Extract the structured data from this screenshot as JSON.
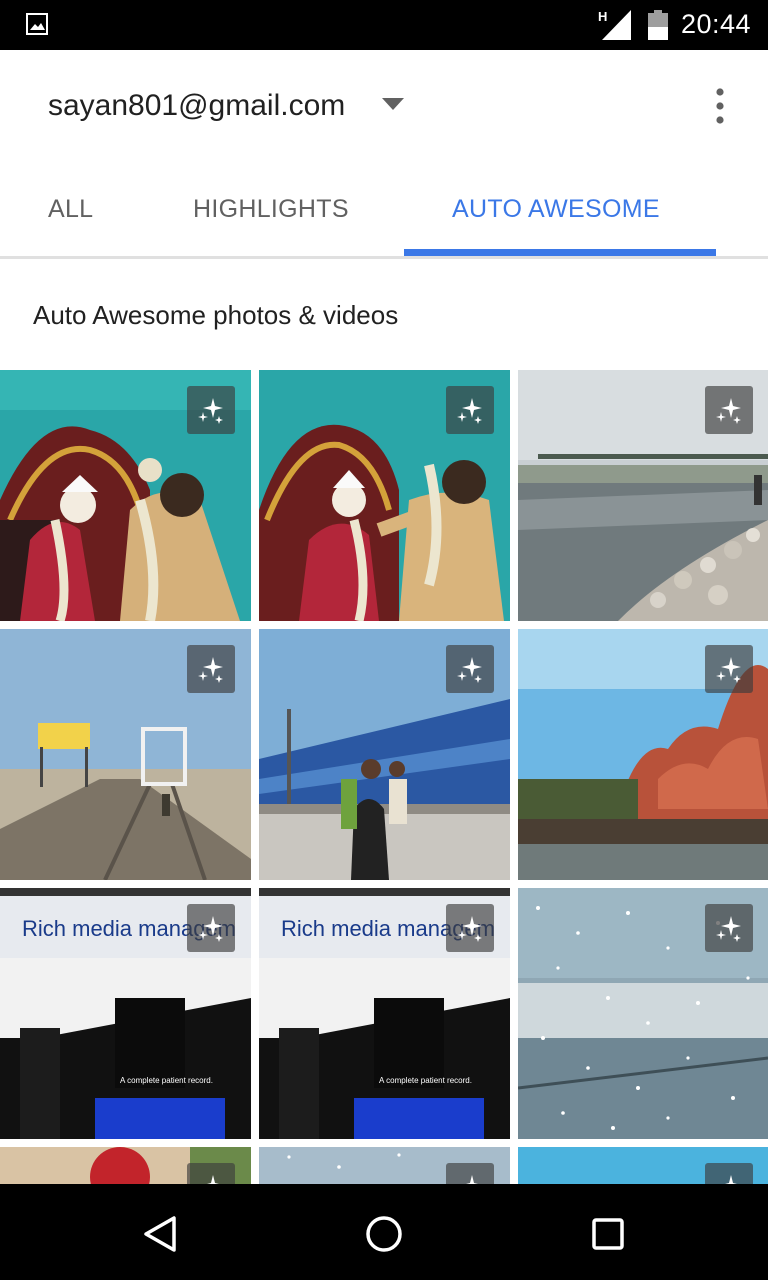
{
  "status_bar": {
    "notification_icon": "image-icon",
    "network_type": "H",
    "signal_icon": "signal-icon",
    "battery_icon": "battery-icon",
    "time": "20:44"
  },
  "header": {
    "account": "sayan801@gmail.com",
    "dropdown_icon": "arrow-drop-down-icon",
    "menu_icon": "more-vert-icon"
  },
  "tabs": [
    {
      "label": "ALL",
      "active": false
    },
    {
      "label": "HIGHLIGHTS",
      "active": false
    },
    {
      "label": "AUTO AWESOME",
      "active": true
    }
  ],
  "accent_color": "#3b78e7",
  "section": {
    "title": "Auto Awesome photos & videos"
  },
  "photos": {
    "badge_icon": "auto-awesome-sparkle-icon",
    "rich_media_text": "Rich media managem",
    "patient_record_text": "A complete patient record."
  },
  "nav_bar": {
    "back_icon": "back-triangle-icon",
    "home_icon": "home-circle-icon",
    "recents_icon": "recents-square-icon"
  }
}
